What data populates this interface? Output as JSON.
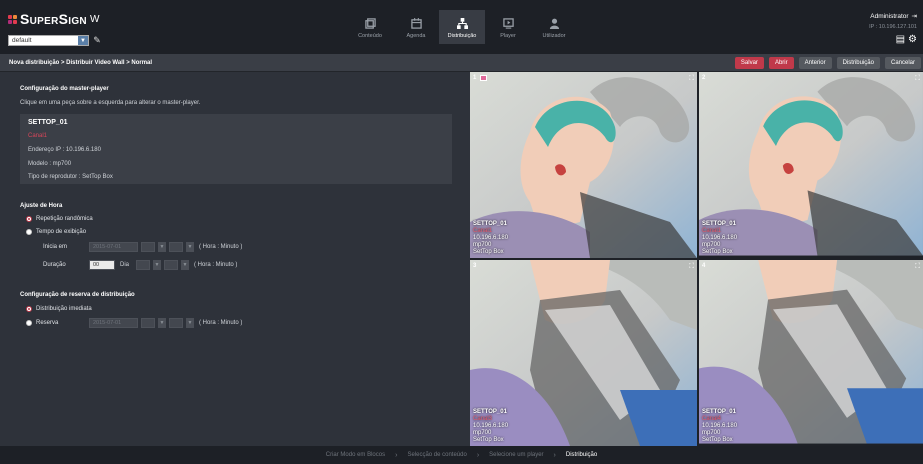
{
  "app": {
    "brand": "SuperSign",
    "brand_suffix": "W",
    "group_select": "default"
  },
  "nav": [
    {
      "label": "Conteúdo",
      "icon": "content-icon"
    },
    {
      "label": "Agenda",
      "icon": "calendar-icon"
    },
    {
      "label": "Distribuição",
      "icon": "distribution-icon",
      "active": true
    },
    {
      "label": "Player",
      "icon": "player-icon"
    },
    {
      "label": "Utilizador",
      "icon": "user-icon"
    }
  ],
  "user": {
    "name": "Administrator",
    "ip": "IP : 10.196.127.101"
  },
  "toolbar": {
    "breadcrumb": "Nova distribuição > Distribuir Video Wall > Normal",
    "save": "Salvar",
    "open": "Abrir",
    "previous": "Anterior",
    "distribute": "Distribuição",
    "cancel": "Cancelar"
  },
  "master": {
    "title": "Configuração do master-player",
    "hint": "Clique em uma peça sobre a esquerda para alterar o master-player.",
    "name": "SETTOP_01",
    "channel": "Canal1",
    "ip": "Endereço IP : 10.196.6.180",
    "model": "Modelo : mp700",
    "type": "Tipo de reprodutor : SetTop Box"
  },
  "time": {
    "title": "Ajuste de Hora",
    "opt_random": "Repetição randômica",
    "opt_display": "Tempo de exibição",
    "start_label": "Inicia em",
    "start_date": "2015-07-01",
    "hour_minute": "( Hora : Minuto )",
    "duration_label": "Duração",
    "duration_value": "00",
    "day_label": "Dia"
  },
  "reserve": {
    "title": "Configuração de reserva de distribuição",
    "opt_immediate": "Distribuição imediata",
    "opt_reserve": "Reserva",
    "date": "2015-07-01",
    "hour_minute": "( Hora : Minuto )"
  },
  "wall": {
    "tiles": [
      {
        "num": "1",
        "name": "SETTOP_01",
        "channel": "Canal1",
        "ip": "10.196.6.180",
        "model": "mp700",
        "type": "SetTop Box"
      },
      {
        "num": "2",
        "name": "SETTOP_01",
        "channel": "Canal1",
        "ip": "10.196.6.180",
        "model": "mp700",
        "type": "SetTop Box"
      },
      {
        "num": "3",
        "name": "SETTOP_01",
        "channel": "Canal3",
        "ip": "10.196.6.180",
        "model": "mp700",
        "type": "SetTop Box"
      },
      {
        "num": "4",
        "name": "SETTOP_01",
        "channel": "Canal4",
        "ip": "10.196.6.180",
        "model": "mp700",
        "type": "SetTop Box"
      }
    ]
  },
  "steps": [
    {
      "label": "Criar Modo em Blocos"
    },
    {
      "label": "Selecção de conteúdo"
    },
    {
      "label": "Selecione um player"
    },
    {
      "label": "Distribuição",
      "active": true
    }
  ],
  "colors": {
    "accent": "#c0394a",
    "header_bg": "#1d2026",
    "panel_bg": "#2e323a"
  }
}
